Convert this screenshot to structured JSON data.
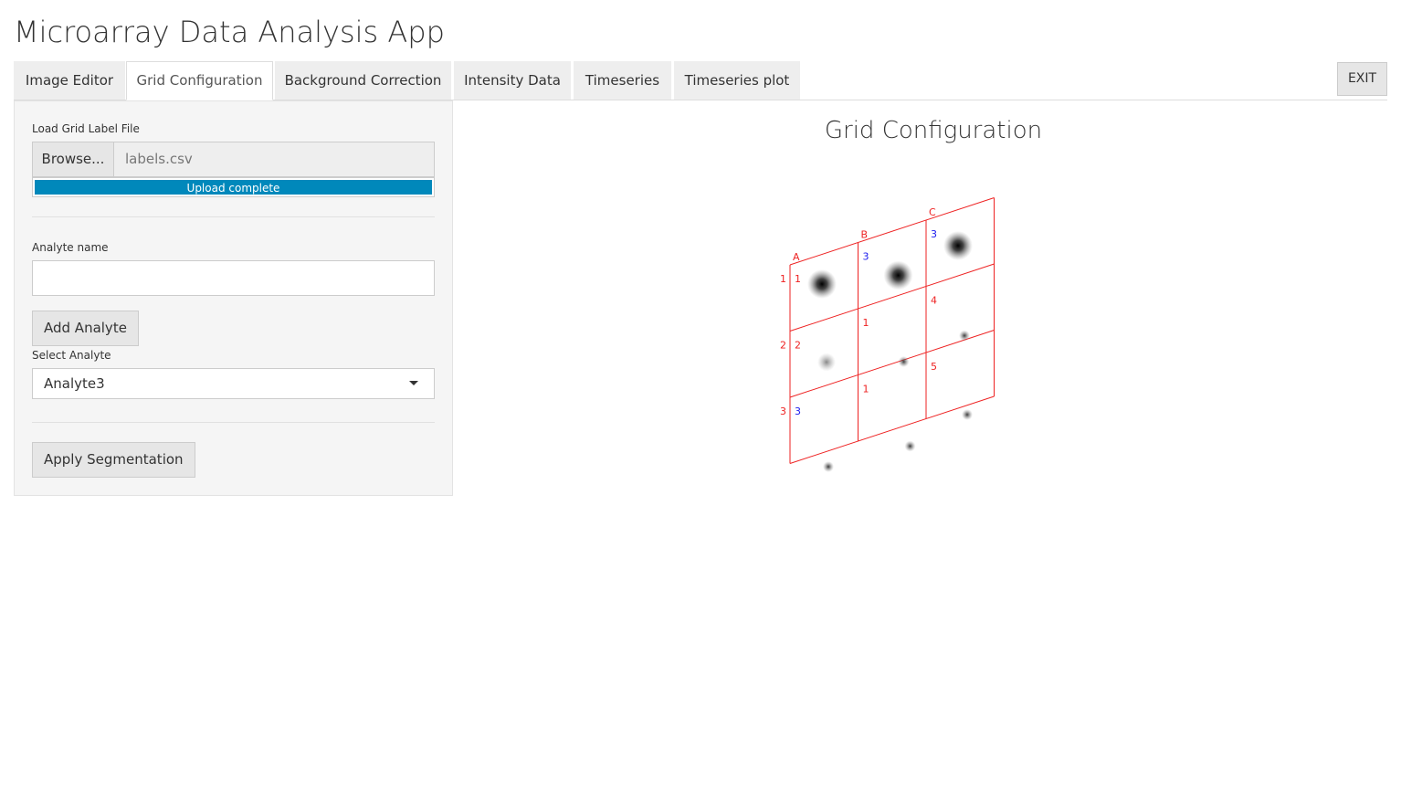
{
  "app": {
    "title": "Microarray Data Analysis App"
  },
  "tabs": [
    {
      "label": "Image Editor",
      "active": false
    },
    {
      "label": "Grid Configuration",
      "active": true
    },
    {
      "label": "Background Correction",
      "active": false
    },
    {
      "label": "Intensity Data",
      "active": false
    },
    {
      "label": "Timeseries",
      "active": false
    },
    {
      "label": "Timeseries plot",
      "active": false
    }
  ],
  "exit_label": "EXIT",
  "sidebar": {
    "grid_label_file": {
      "label": "Load Grid Label File",
      "browse_label": "Browse...",
      "file_name": "labels.csv",
      "progress_label": "Upload complete",
      "progress_fraction": 1.0
    },
    "analyte_name": {
      "label": "Analyte name",
      "value": ""
    },
    "add_analyte_label": "Add Analyte",
    "select_analyte": {
      "label": "Select Analyte",
      "selected": "Analyte3"
    },
    "apply_segmentation_label": "Apply Segmentation"
  },
  "main": {
    "title": "Grid Configuration"
  },
  "grid": {
    "line_color": "#ee2222",
    "highlight_color": "#1a1aee",
    "columns": [
      "A",
      "B",
      "C"
    ],
    "rows": [
      "1",
      "2",
      "3"
    ],
    "cells": [
      {
        "label": "1",
        "color": "red",
        "spot": "large-dark"
      },
      {
        "label": "3",
        "color": "blue",
        "spot": "large-dark"
      },
      {
        "label": "3",
        "color": "blue",
        "spot": "large-dark"
      },
      {
        "label": "2",
        "color": "red",
        "spot": "medium-faint"
      },
      {
        "label": "1",
        "color": "red",
        "spot": "small"
      },
      {
        "label": "4",
        "color": "red",
        "spot": "small"
      },
      {
        "label": "3",
        "color": "blue",
        "spot": "small"
      },
      {
        "label": "1",
        "color": "red",
        "spot": "small"
      },
      {
        "label": "5",
        "color": "red",
        "spot": "small"
      }
    ]
  }
}
